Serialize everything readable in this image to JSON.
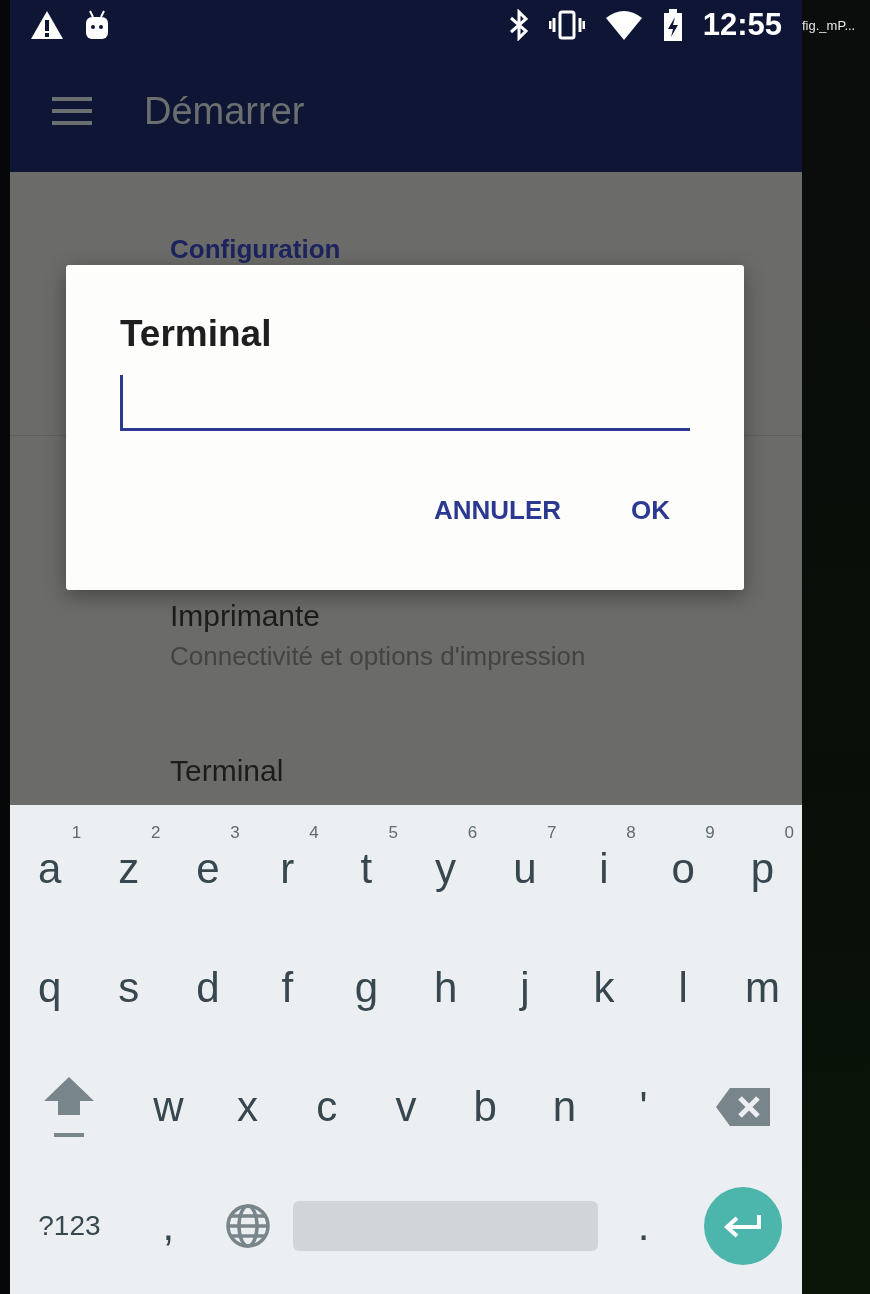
{
  "status_bar": {
    "time": "12:55"
  },
  "side_label": "fig._mP...",
  "app_bar": {
    "title": "Démarrer"
  },
  "settings": {
    "section": "Configuration",
    "items": [
      {
        "title": "Imprimante",
        "subtitle": "Connectivité et options d'impression"
      },
      {
        "title": "Terminal"
      }
    ]
  },
  "dialog": {
    "title": "Terminal",
    "buttons": [
      "ANNULER",
      "OK"
    ]
  },
  "keyboard": {
    "rows": [
      [
        {
          "kind": "letter",
          "label": "a",
          "hint": "1"
        },
        {
          "kind": "letter",
          "label": "z",
          "hint": "2"
        },
        {
          "kind": "letter",
          "label": "e",
          "hint": "3"
        },
        {
          "kind": "letter",
          "label": "r",
          "hint": "4"
        },
        {
          "kind": "letter",
          "label": "t",
          "hint": "5"
        },
        {
          "kind": "letter",
          "label": "y",
          "hint": "6"
        },
        {
          "kind": "letter",
          "label": "u",
          "hint": "7"
        },
        {
          "kind": "letter",
          "label": "i",
          "hint": "8"
        },
        {
          "kind": "letter",
          "label": "o",
          "hint": "9"
        },
        {
          "kind": "letter",
          "label": "p",
          "hint": "0"
        }
      ],
      [
        {
          "kind": "letter",
          "label": "q"
        },
        {
          "kind": "letter",
          "label": "s"
        },
        {
          "kind": "letter",
          "label": "d"
        },
        {
          "kind": "letter",
          "label": "f"
        },
        {
          "kind": "letter",
          "label": "g"
        },
        {
          "kind": "letter",
          "label": "h"
        },
        {
          "kind": "letter",
          "label": "j"
        },
        {
          "kind": "letter",
          "label": "k"
        },
        {
          "kind": "letter",
          "label": "l"
        },
        {
          "kind": "letter",
          "label": "m"
        }
      ],
      [
        {
          "kind": "shift"
        },
        {
          "kind": "letter",
          "label": "w"
        },
        {
          "kind": "letter",
          "label": "x"
        },
        {
          "kind": "letter",
          "label": "c"
        },
        {
          "kind": "letter",
          "label": "v"
        },
        {
          "kind": "letter",
          "label": "b"
        },
        {
          "kind": "letter",
          "label": "n"
        },
        {
          "kind": "letter",
          "label": "'"
        },
        {
          "kind": "backspace"
        }
      ],
      [
        {
          "kind": "mode",
          "label": "?123"
        },
        {
          "kind": "letter",
          "label": ","
        },
        {
          "kind": "globe"
        },
        {
          "kind": "space"
        },
        {
          "kind": "letter",
          "label": "."
        },
        {
          "kind": "enter"
        }
      ]
    ]
  }
}
